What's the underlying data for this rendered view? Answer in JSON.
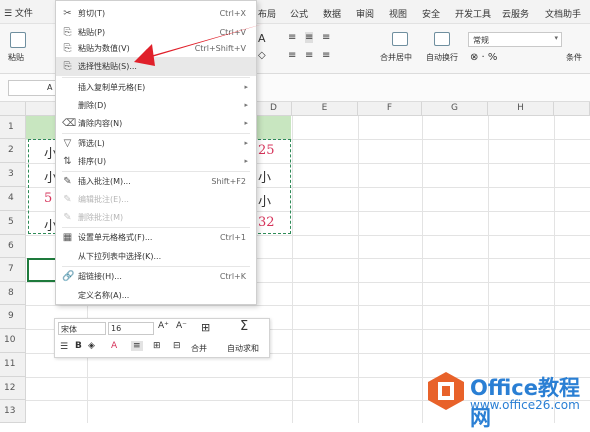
{
  "menubar": {
    "file_label": "☰ 文件",
    "tabs": [
      "布局",
      "公式",
      "数据",
      "审阅",
      "视图",
      "安全",
      "开发工具",
      "云服务",
      "文档助手"
    ]
  },
  "ribbon": {
    "paste_label": "粘贴",
    "merge_label": "合并居中",
    "wrap_label": "自动换行",
    "number_format": "常规",
    "conditional_label": "条件"
  },
  "namebox": {
    "value": "A"
  },
  "columns": [
    "D",
    "E",
    "F",
    "G",
    "H"
  ],
  "rows": [
    "1",
    "2",
    "3",
    "4",
    "5",
    "6",
    "7",
    "8",
    "9",
    "10",
    "11",
    "12",
    "13"
  ],
  "cells": {
    "r2_a": "小",
    "r3_a": "小",
    "r4_a": "5",
    "r5_a": "小",
    "r2_d": "25",
    "r3_d": "小",
    "r4_d": "小",
    "r5_d": "32"
  },
  "context_menu": {
    "items": [
      {
        "icon": "✂",
        "label": "剪切(T)",
        "shortcut": "Ctrl+X"
      },
      {
        "icon": "⎘",
        "label": "粘贴(P)",
        "shortcut": "Ctrl+V"
      },
      {
        "icon": "⎘",
        "label": "粘贴为数值(V)",
        "shortcut": "Ctrl+Shift+V"
      },
      {
        "icon": "⎘",
        "label": "选择性粘贴(S)...",
        "shortcut": ""
      },
      {
        "icon": "",
        "label": "插入复制单元格(E)",
        "shortcut": "▸"
      },
      {
        "icon": "",
        "label": "删除(D)",
        "shortcut": "▸"
      },
      {
        "icon": "⌫",
        "label": "清除内容(N)",
        "shortcut": "▸"
      },
      {
        "icon": "▽",
        "label": "筛选(L)",
        "shortcut": "▸"
      },
      {
        "icon": "⇅",
        "label": "排序(U)",
        "shortcut": "▸"
      },
      {
        "icon": "✎",
        "label": "插入批注(M)...",
        "shortcut": "Shift+F2"
      },
      {
        "icon": "✎",
        "label": "编辑批注(E)...",
        "shortcut": ""
      },
      {
        "icon": "✎",
        "label": "删除批注(M)",
        "shortcut": ""
      },
      {
        "icon": "▦",
        "label": "设置单元格格式(F)...",
        "shortcut": "Ctrl+1"
      },
      {
        "icon": "",
        "label": "从下拉列表中选择(K)...",
        "shortcut": ""
      },
      {
        "icon": "🔗",
        "label": "超链接(H)...",
        "shortcut": "Ctrl+K"
      },
      {
        "icon": "",
        "label": "定义名称(A)...",
        "shortcut": ""
      }
    ]
  },
  "mini_toolbar": {
    "font_name": "宋体",
    "font_size": "16",
    "merge_label": "合并",
    "autosum_label": "自动求和"
  },
  "watermark": {
    "title": "Office教程网",
    "url": "www.office26.com",
    "brand_color": "#2a7fd4",
    "logo_color": "#e8622a"
  },
  "colors": {
    "accent_green": "#1e7a3c",
    "arrow_red": "#e0202a"
  }
}
